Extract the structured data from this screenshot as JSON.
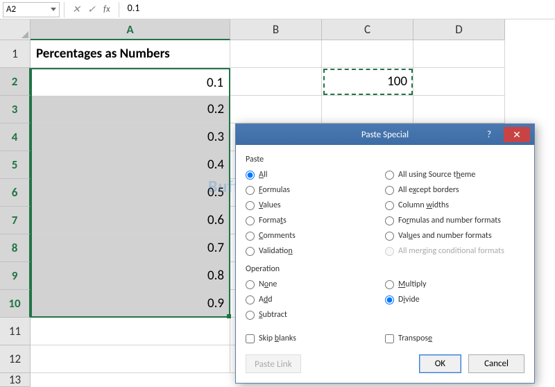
{
  "nameBox": "A2",
  "formulaBar": "0.1",
  "fx_label": "fx",
  "cancel_glyph": "✕",
  "enter_glyph": "✓",
  "columns": [
    "A",
    "B",
    "C",
    "D"
  ],
  "rows": [
    "1",
    "2",
    "3",
    "4",
    "5",
    "6",
    "7",
    "8",
    "9",
    "10",
    "11",
    "12",
    "13"
  ],
  "header_cell": "Percentages as Numbers",
  "col_a_values": [
    "0.1",
    "0.2",
    "0.3",
    "0.4",
    "0.5",
    "0.6",
    "0.7",
    "0.8",
    "0.9"
  ],
  "c2_value": "100",
  "watermark": "Buffcom",
  "dialog": {
    "title": "Paste Special",
    "help": "?",
    "close": "✕",
    "paste_label": "Paste",
    "operation_label": "Operation",
    "paste_left": [
      {
        "pre": "",
        "u": "A",
        "post": "ll",
        "sel": true
      },
      {
        "pre": "",
        "u": "F",
        "post": "ormulas",
        "sel": false
      },
      {
        "pre": "",
        "u": "V",
        "post": "alues",
        "sel": false
      },
      {
        "pre": "Forma",
        "u": "t",
        "post": "s",
        "sel": false
      },
      {
        "pre": "",
        "u": "C",
        "post": "omments",
        "sel": false
      },
      {
        "pre": "Validatio",
        "u": "n",
        "post": "",
        "sel": false
      }
    ],
    "paste_right": [
      {
        "pre": "All using Source t",
        "u": "h",
        "post": "eme",
        "sel": false,
        "dis": false
      },
      {
        "pre": "All e",
        "u": "x",
        "post": "cept borders",
        "sel": false,
        "dis": false
      },
      {
        "pre": "Column ",
        "u": "w",
        "post": "idths",
        "sel": false,
        "dis": false
      },
      {
        "pre": "Fo",
        "u": "r",
        "post": "mulas and number formats",
        "sel": false,
        "dis": false
      },
      {
        "pre": "Val",
        "u": "u",
        "post": "es and number formats",
        "sel": false,
        "dis": false
      },
      {
        "pre": "All mer",
        "u": "g",
        "post": "ing conditional formats",
        "sel": false,
        "dis": true
      }
    ],
    "op_left": [
      {
        "pre": "N",
        "u": "o",
        "post": "ne",
        "sel": false
      },
      {
        "pre": "A",
        "u": "d",
        "post": "d",
        "sel": false
      },
      {
        "pre": "",
        "u": "S",
        "post": "ubtract",
        "sel": false
      }
    ],
    "op_right": [
      {
        "pre": "",
        "u": "M",
        "post": "ultiply",
        "sel": false
      },
      {
        "pre": "D",
        "u": "i",
        "post": "vide",
        "sel": true
      }
    ],
    "skip_blanks": "Skip blanks",
    "skip_u": "b",
    "transpose": "Transpose",
    "transpose_u": "E",
    "paste_link": "Paste Link",
    "ok": "OK",
    "cancel": "Cancel"
  }
}
